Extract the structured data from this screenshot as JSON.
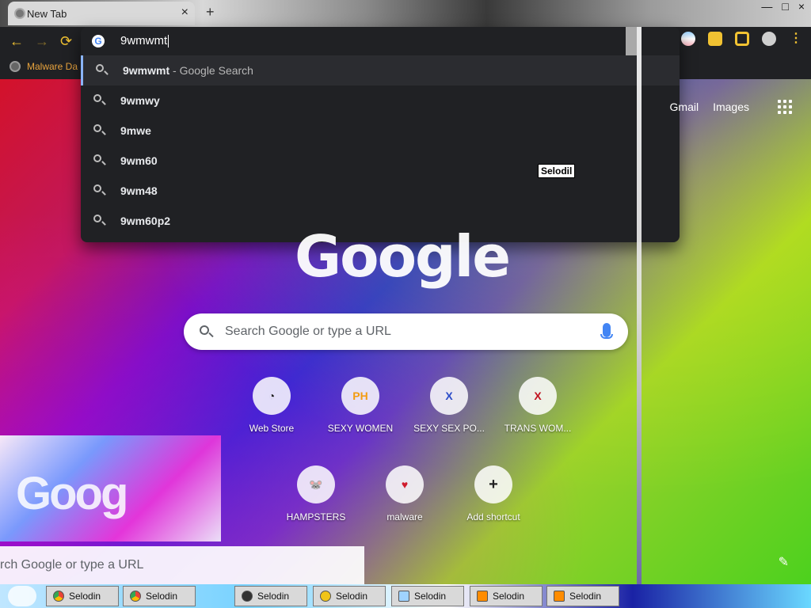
{
  "window": {
    "tab_title": "New Tab",
    "tab_close": "×",
    "new_tab": "+",
    "minimize": "—",
    "maximize": "□",
    "close": "×"
  },
  "nav": {
    "back": "←",
    "forward": "→",
    "reload": "⟳"
  },
  "omnibox": {
    "typed_text": "9wmwmt",
    "g_icon": "G",
    "suggestions": [
      {
        "main": "9wmwmt",
        "suffix": " - Google Search"
      },
      {
        "main": "9wmwy",
        "suffix": ""
      },
      {
        "main": "9mwe",
        "suffix": ""
      },
      {
        "main": "9wm60",
        "suffix": ""
      },
      {
        "main": "9wm48",
        "suffix": ""
      },
      {
        "main": "9wm60p2",
        "suffix": ""
      }
    ]
  },
  "bookmarks": {
    "items": [
      {
        "label": "Malware Da"
      }
    ]
  },
  "google": {
    "gmail": "Gmail",
    "images": "Images",
    "logo": "Google",
    "search_placeholder": "Search Google or type a URL",
    "shortcuts": [
      {
        "label": "Web Store",
        "icon_text": "◔"
      },
      {
        "label": "SEXY WOMEN",
        "icon_text": "PH"
      },
      {
        "label": "SEXY SEX PO...",
        "icon_text": "X"
      },
      {
        "label": "TRANS WOM...",
        "icon_text": "X"
      },
      {
        "label": "HAMPSTERS",
        "icon_text": "🐭"
      },
      {
        "label": "malware",
        "icon_text": "♥"
      },
      {
        "label": "Add shortcut",
        "icon_text": "+"
      }
    ]
  },
  "glitch": {
    "popup_label": "Selodil",
    "overlay_logo": "Goog",
    "overlay_search_text": "rch Google or type a URL"
  },
  "taskbar": {
    "items": [
      {
        "label": "Selodin",
        "icon": "chrome"
      },
      {
        "label": "Selodin",
        "icon": "chrome"
      },
      {
        "label": "Selodin",
        "icon": "user"
      },
      {
        "label": "Selodin",
        "icon": "emoji"
      },
      {
        "label": "Selodin",
        "icon": "notepad"
      },
      {
        "label": "Selodin",
        "icon": "vlc"
      },
      {
        "label": "Selodin",
        "icon": "vlc"
      }
    ]
  }
}
